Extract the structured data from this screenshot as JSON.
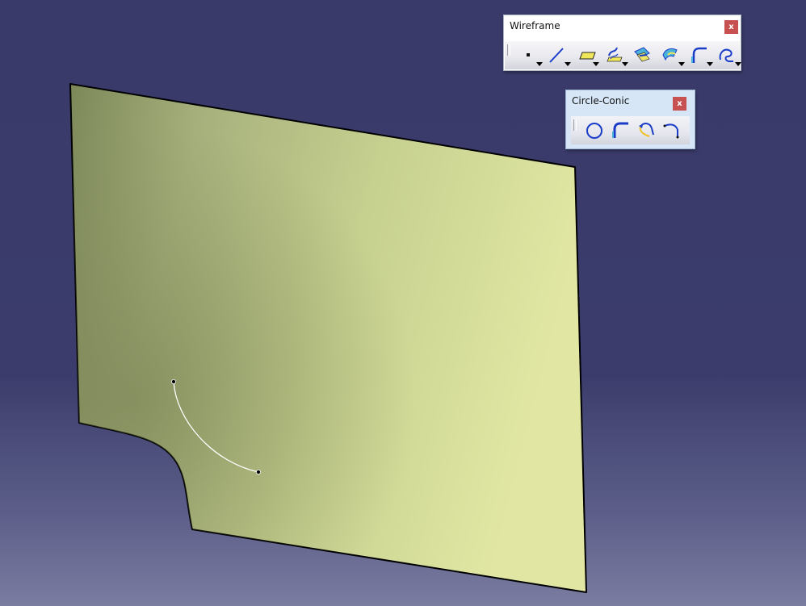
{
  "toolbars": {
    "wireframe": {
      "title": "Wireframe",
      "close_label": "x",
      "tools": [
        {
          "icon": "point-icon",
          "dropdown": true
        },
        {
          "icon": "line-icon",
          "dropdown": true
        },
        {
          "icon": "plane-icon",
          "dropdown": true
        },
        {
          "icon": "projection-icon",
          "dropdown": true
        },
        {
          "icon": "intersection-icon",
          "dropdown": false
        },
        {
          "icon": "offset-icon",
          "dropdown": true
        },
        {
          "icon": "corner-icon",
          "dropdown": true
        },
        {
          "icon": "spline-icon",
          "dropdown": true
        }
      ]
    },
    "circle_conic": {
      "title": "Circle-Conic",
      "close_label": "x",
      "tools": [
        {
          "icon": "circle-icon"
        },
        {
          "icon": "corner-icon"
        },
        {
          "icon": "connect-curve-icon"
        },
        {
          "icon": "conic-icon"
        }
      ]
    }
  },
  "colors": {
    "background_top": "#393a6a",
    "background_bottom": "#7a7ca0",
    "surface_dark": "#7f8a5c",
    "surface_light": "#e0e6a2",
    "arc": "#ffffff",
    "icon_blue": "#1a3cc8",
    "icon_yellow": "#f0e65a"
  }
}
